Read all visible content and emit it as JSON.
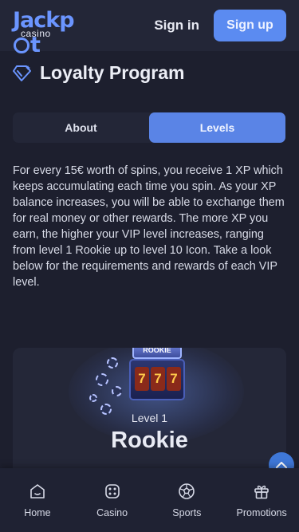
{
  "header": {
    "logo_main_left": "Jackp",
    "logo_main_right": "t",
    "logo_sub": "casino",
    "signin_label": "Sign in",
    "signup_label": "Sign up"
  },
  "page": {
    "title": "Loyalty Program",
    "title_icon": "diamond-icon"
  },
  "tabs": [
    {
      "label": "About",
      "active": false
    },
    {
      "label": "Levels",
      "active": true
    }
  ],
  "description": "For every 15€ worth of spins, you receive 1 XP which keeps accumulating each time you spin. As your XP balance increases, you will be able to exchange them for real money or other rewards. The more XP you earn, the higher your VIP level increases, ranging from level 1 Rookie up to level 10 Icon. Take a look below for the requirements and rewards of each VIP level.",
  "level_card": {
    "machine_label": "ROOKIE",
    "reels": [
      "7",
      "7",
      "7"
    ],
    "level_number": "Level 1",
    "level_name": "Rookie"
  },
  "bottom_nav": [
    {
      "label": "Home",
      "icon": "home-icon"
    },
    {
      "label": "Casino",
      "icon": "dice-icon"
    },
    {
      "label": "Sports",
      "icon": "soccer-ball-icon"
    },
    {
      "label": "Promotions",
      "icon": "gift-icon"
    }
  ],
  "colors": {
    "background": "#1d1f2e",
    "header": "#232637",
    "accent": "#5b8bf1",
    "active_tab": "#5a84e6",
    "scroll_button": "#3f78d8"
  }
}
